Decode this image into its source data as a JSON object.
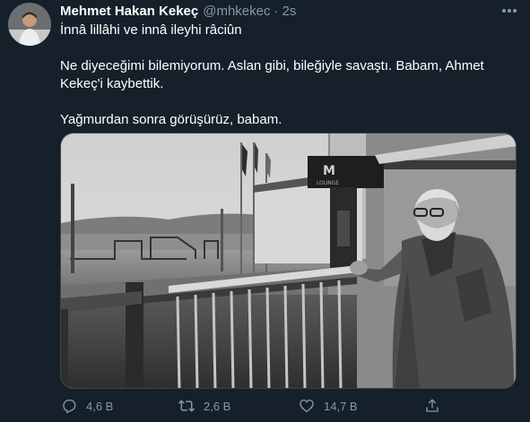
{
  "tweet": {
    "author_name": "Mehmet Hakan Kekeç",
    "handle": "@mhkekec",
    "separator": "·",
    "time": "2s",
    "paragraphs": [
      "İnnâ lillâhi ve innâ ileyhi râciûn",
      "Ne diyeceğimi bilemiyorum. Aslan gibi, bileğiyle savaştı. Babam, Ahmet Kekeç'i kaybettik.",
      "Yağmurdan sonra görüşürüz, babam."
    ],
    "photo_sign_text": "LOUNGE",
    "actions": {
      "reply_count": "4,6 B",
      "retweet_count": "2,6 B",
      "like_count": "14,7 B"
    }
  },
  "icons": {
    "more": "more-dots-icon",
    "reply": "reply-icon",
    "retweet": "retweet-icon",
    "like": "heart-icon",
    "share": "share-icon"
  },
  "colors": {
    "background": "#15202b",
    "secondary_text": "#8899a6",
    "primary_text": "#ffffff",
    "border": "#38444d"
  }
}
